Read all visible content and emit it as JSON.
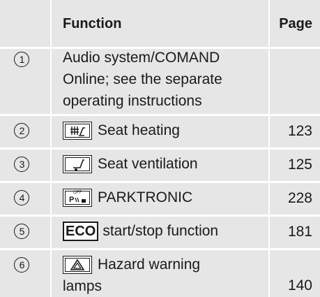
{
  "header": {
    "function": "Function",
    "page": "Page"
  },
  "rows": [
    {
      "num": "1",
      "text": "Audio system/COMAND Online; see the separate operating instructions",
      "lines": [
        "Audio system/COMAND",
        "Online; see the separate",
        "operating instructions"
      ],
      "page": ""
    },
    {
      "num": "2",
      "icon": "seat-heating-icon",
      "text": "Seat heating",
      "page": "123"
    },
    {
      "num": "3",
      "icon": "seat-ventilation-icon",
      "text": "Seat ventilation",
      "page": "125"
    },
    {
      "num": "4",
      "icon": "parktronic-icon",
      "icon_label": "OFF",
      "text": "PARKTRONIC",
      "page": "228"
    },
    {
      "num": "5",
      "icon": "eco-button-icon",
      "icon_label": "ECO",
      "text": "start/stop function",
      "page": "181"
    },
    {
      "num": "6",
      "icon": "hazard-warning-icon",
      "text": "Hazard warning",
      "text2": "lamps",
      "page": "140"
    }
  ]
}
